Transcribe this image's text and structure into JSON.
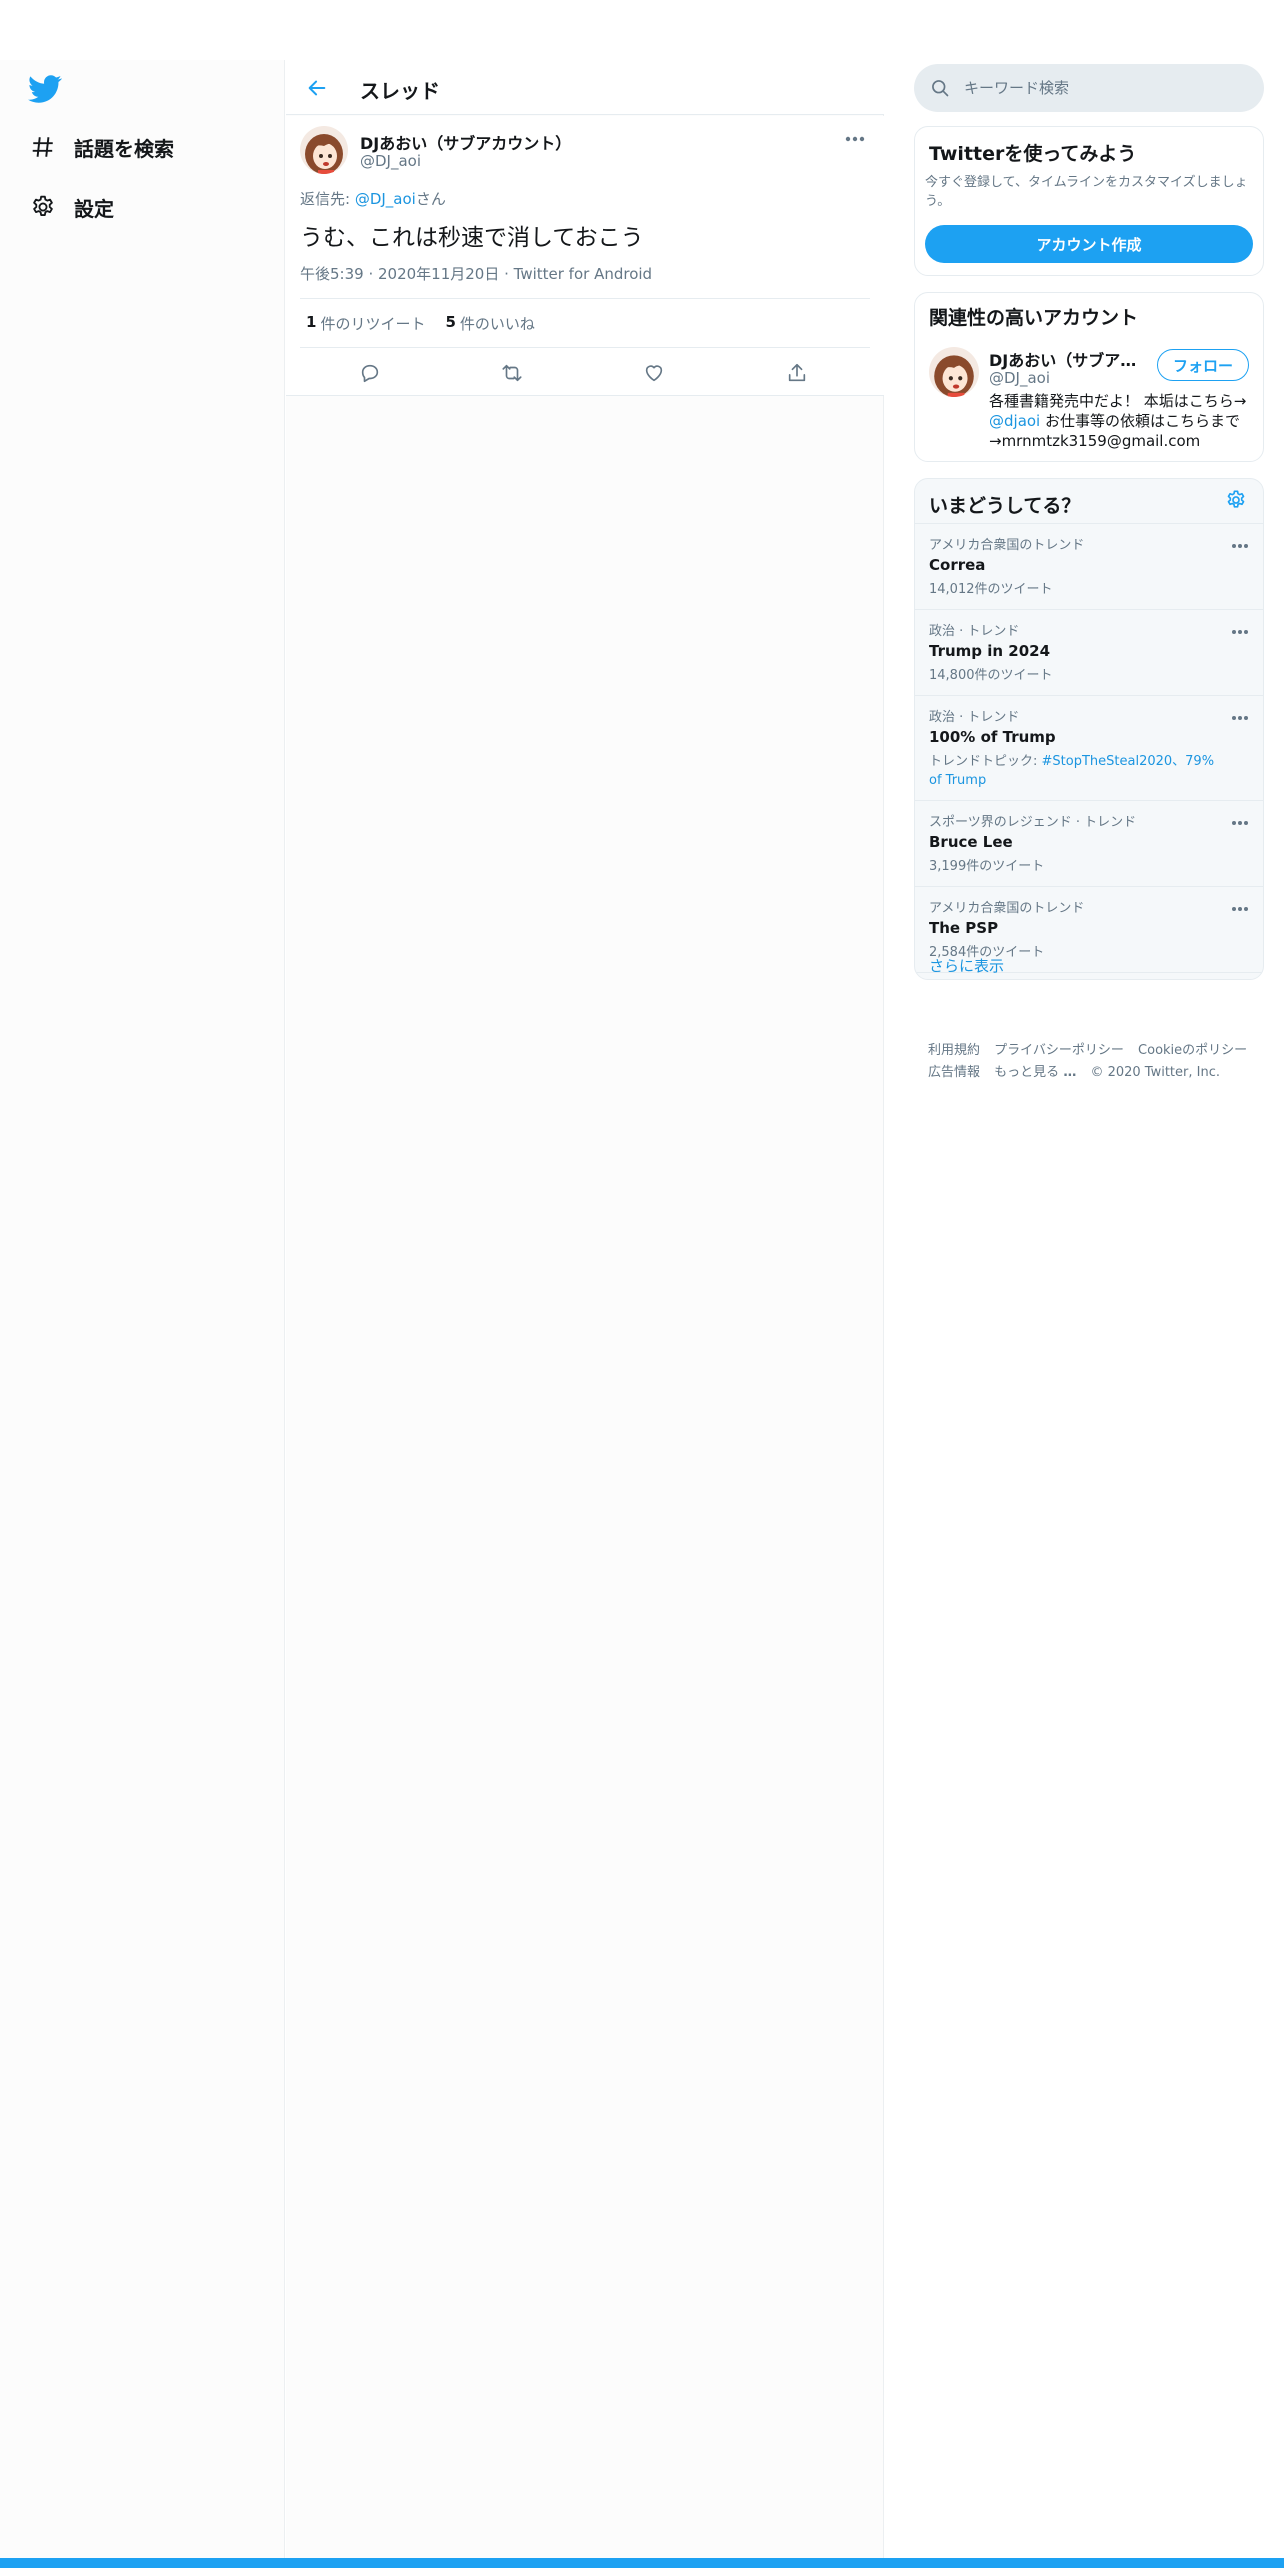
{
  "nav": {
    "explore_label": "話題を検索",
    "settings_label": "設定"
  },
  "header": {
    "title": "スレッド"
  },
  "tweet": {
    "user_name": "DJあおい（サブアカウント）",
    "user_handle": "@DJ_aoi",
    "reply_prefix": "返信先: ",
    "reply_mention": "@DJ_aoi",
    "reply_suffix": "さん",
    "text": "うむ、これは秒速で消しておこう",
    "meta": "午後5:39 · 2020年11月20日 · Twitter for Android",
    "retweet_count": "1",
    "retweet_label": "件のリツイート",
    "like_count": "5",
    "like_label": "件のいいね"
  },
  "search": {
    "placeholder": "キーワード検索"
  },
  "signup_card": {
    "title": "Twitterを使ってみよう",
    "description": "今すぐ登録して、タイムラインをカスタマイズしましょう。",
    "button_label": "アカウント作成"
  },
  "related_card": {
    "title": "関連性の高いアカウント",
    "name": "DJあおい（サブアカウント）",
    "handle": "@DJ_aoi",
    "follow_label": "フォロー",
    "bio_part1": "各種書籍発売中だよ！ 本垢はこちら→ ",
    "bio_mention": "@djaoi",
    "bio_part2": " お仕事等の依頼はこちらまで→mrnmtzk3159@gmail.com"
  },
  "trends_card": {
    "title": "いまどうしてる？",
    "show_more": "さらに表示",
    "items": [
      {
        "category": "アメリカ合衆国のトレンド",
        "name": "Correa",
        "count": "14,012件のツイート"
      },
      {
        "category": "政治 · トレンド",
        "name": "Trump in 2024",
        "count": "14,800件のツイート"
      },
      {
        "category": "政治 · トレンド",
        "name": "100% of Trump",
        "topic_prefix": "トレンドトピック: ",
        "topic_links": "#StopTheSteal2020、79% of Trump"
      },
      {
        "category": "スポーツ界のレジェンド · トレンド",
        "name": "Bruce Lee",
        "count": "3,199件のツイート"
      },
      {
        "category": "アメリカ合衆国のトレンド",
        "name": "The PSP",
        "count": "2,584件のツイート"
      }
    ]
  },
  "footer": {
    "terms": "利用規約",
    "privacy": "プライバシーポリシー",
    "cookie": "Cookieのポリシー",
    "ads": "広告情報",
    "more": "もっと見る",
    "copyright": "© 2020 Twitter, Inc."
  },
  "colors": {
    "accent": "#1da1f2",
    "link": "#1b95e0",
    "secondary_text": "#657786"
  }
}
